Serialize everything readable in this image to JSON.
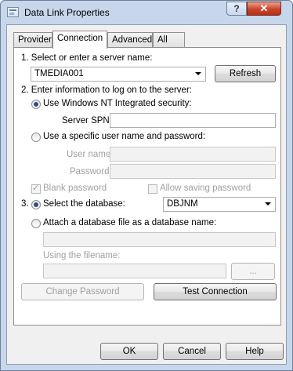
{
  "window": {
    "title": "Data Link Properties",
    "help_symbol": "?",
    "close_symbol": "✕"
  },
  "tabs": [
    "Provider",
    "Connection",
    "Advanced",
    "All"
  ],
  "step1": {
    "label": "1. Select or enter a server name:",
    "server_value": "TMEDIA001",
    "refresh_label": "Refresh"
  },
  "step2": {
    "label": "2. Enter information to log on to the server:",
    "option_nt": "Use Windows NT Integrated security:",
    "spn_label": "Server SPN:",
    "spn_value": "",
    "option_specific": "Use a specific user name and password:",
    "username_label": "User name:",
    "password_label": "Password:",
    "blank_password": "Blank password",
    "allow_saving": "Allow saving password"
  },
  "step3": {
    "number": "3.",
    "option_select_db": "Select the database:",
    "database_value": "DBJNM",
    "option_attach": "Attach a database file as a database name:",
    "using_filename": "Using the filename:",
    "browse_label": "..."
  },
  "actions": {
    "change_password": "Change Password",
    "test_connection": "Test Connection"
  },
  "footer": {
    "ok": "OK",
    "cancel": "Cancel",
    "help": "Help"
  }
}
